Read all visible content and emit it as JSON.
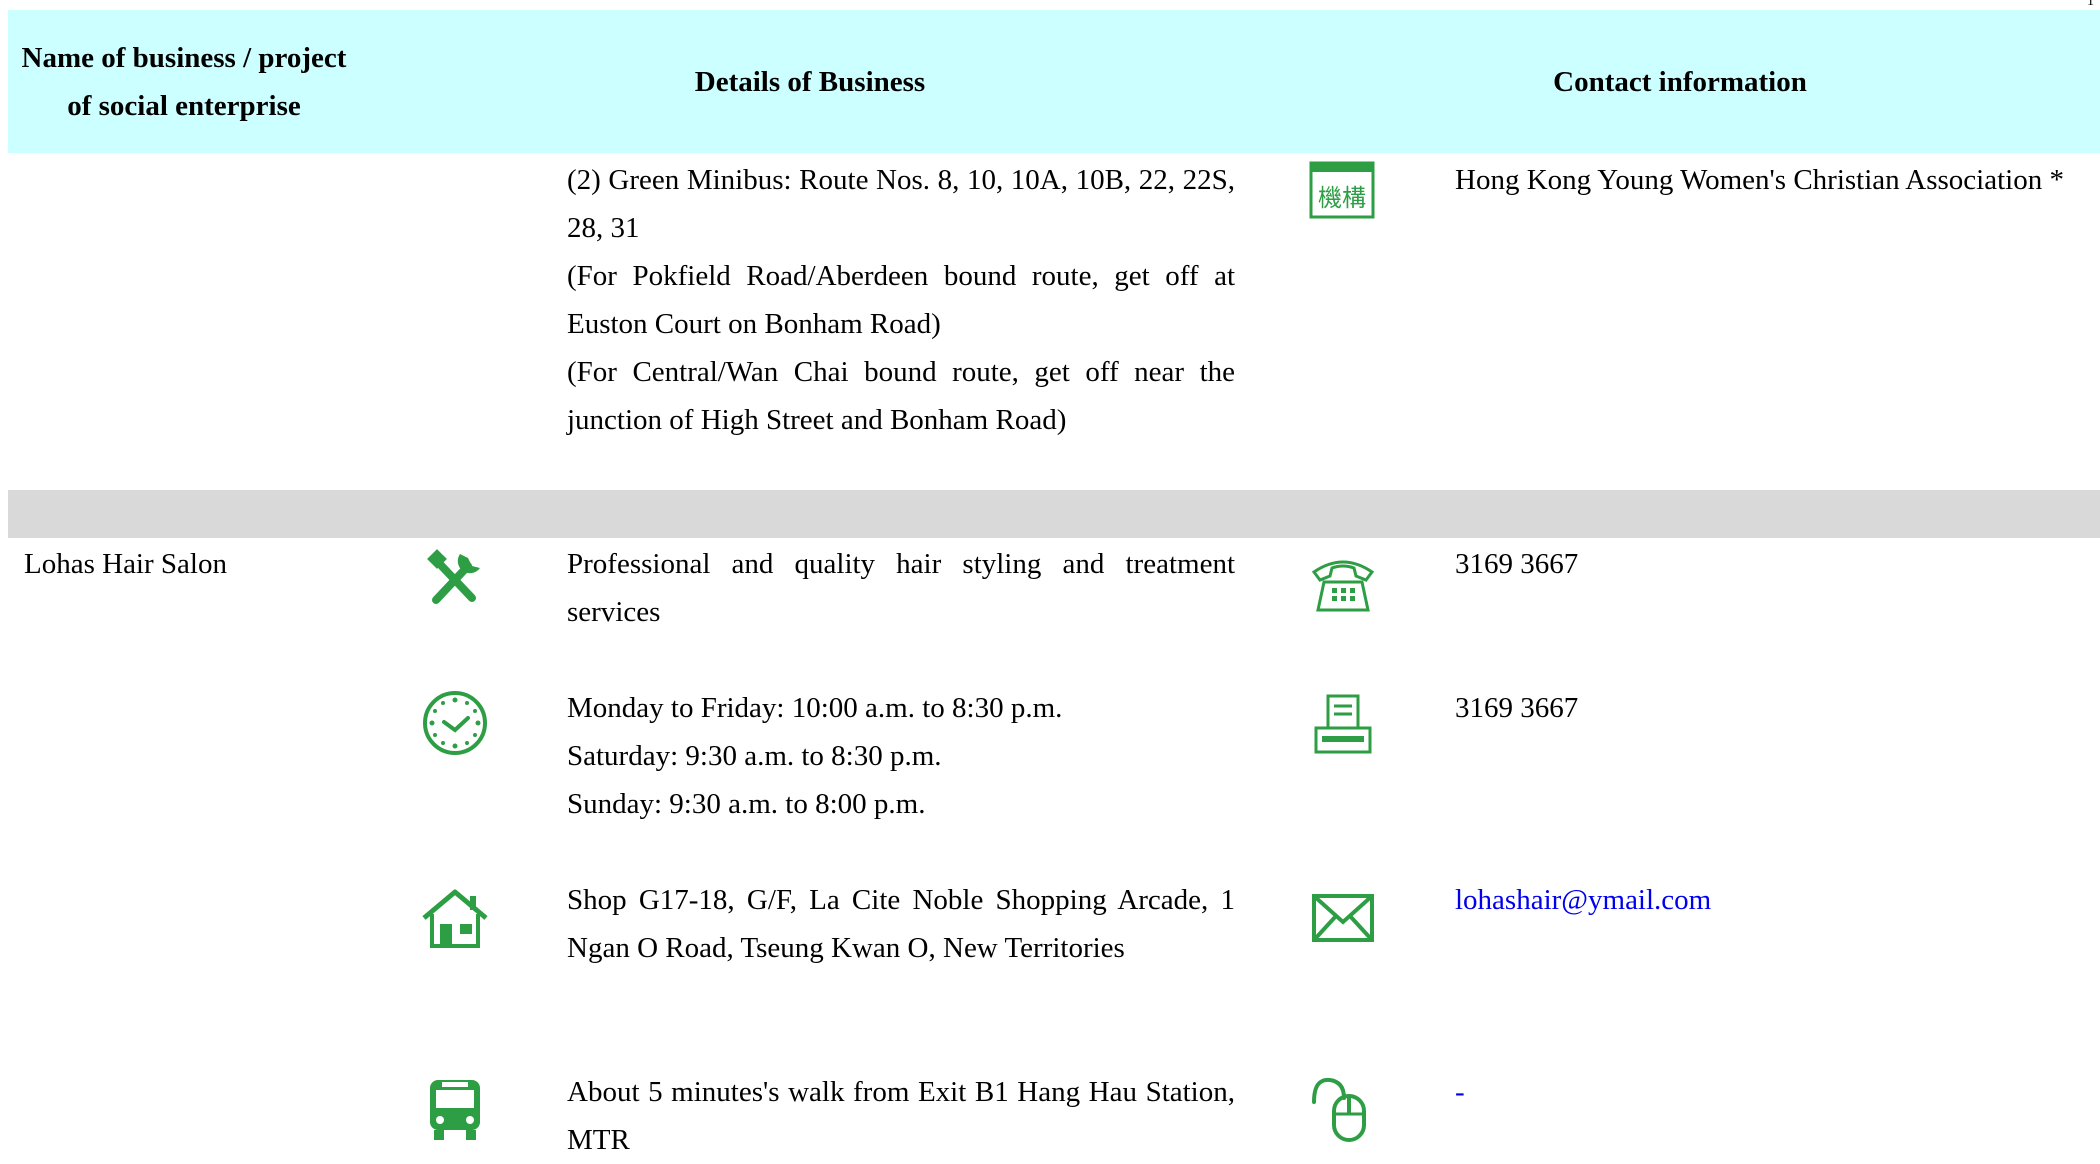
{
  "page_number": "1",
  "header": {
    "col_name": "Name of business / project of social enterprise",
    "col_details": "Details of Business",
    "col_contact": "Contact information"
  },
  "prev_entry": {
    "transport_lines": [
      "(2) Green Minibus: Route Nos. 8, 10, 10A, 10B, 22, 22S, 28, 31",
      "(For Pokfield Road/Aberdeen bound route, get off at Euston Court on Bonham Road)",
      "(For Central/Wan Chai bound route, get off near the junction of High Street and Bonham Road)"
    ],
    "organisation_icon_text": "機構",
    "organisation": "Hong Kong Young Women's Christian Association *"
  },
  "entry": {
    "name": "Lohas Hair Salon",
    "service": "Professional and quality hair styling and treatment services",
    "hours_lines": [
      "Monday to Friday: 10:00 a.m. to 8:30 p.m.",
      "Saturday: 9:30 a.m. to 8:30 p.m.",
      "Sunday: 9:30 a.m. to 8:00 p.m."
    ],
    "address": "Shop G17-18, G/F, La Cite Noble Shopping Arcade, 1 Ngan O Road, Tseung Kwan O, New Territories",
    "transport": "About 5 minutes's walk from Exit B1 Hang Hau Station, MTR",
    "phone": "3169 3667",
    "fax": "3169 3667",
    "email": "lohashair@ymail.com",
    "website": "-"
  },
  "colors": {
    "header_bg": "#ccffff",
    "separator": "#d9d9d9",
    "icon_green": "#2e9e45",
    "link": "#0000ee"
  },
  "icons": [
    "organisation-icon",
    "tools-icon",
    "clock-icon",
    "house-icon",
    "bus-icon",
    "phone-icon",
    "fax-icon",
    "mail-icon",
    "mouse-icon"
  ]
}
